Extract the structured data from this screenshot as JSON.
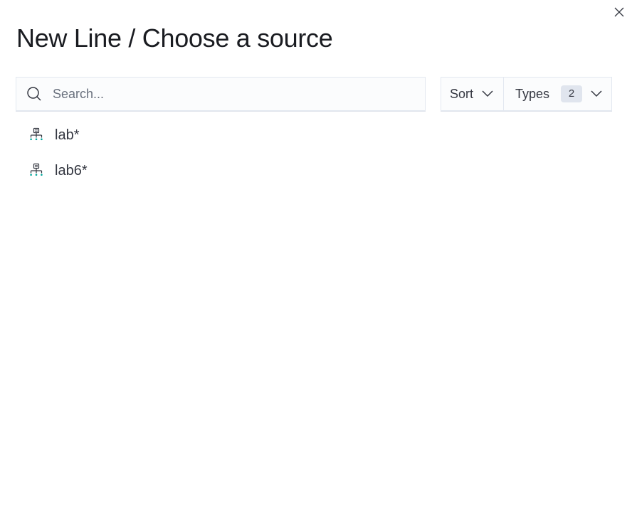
{
  "dialog": {
    "title": "New Line / Choose a source",
    "close_icon": "close-icon"
  },
  "search": {
    "icon": "search-icon",
    "placeholder": "Search...",
    "value": ""
  },
  "filters": {
    "sort_label": "Sort",
    "types_label": "Types",
    "types_count": "2"
  },
  "results": [
    {
      "label": "lab*",
      "icon": "index-pattern-icon"
    },
    {
      "label": "lab6*",
      "icon": "index-pattern-icon"
    }
  ],
  "colors": {
    "icon_accent": "#00a69b",
    "text": "#343741",
    "badge_bg": "#e0e5ee"
  }
}
